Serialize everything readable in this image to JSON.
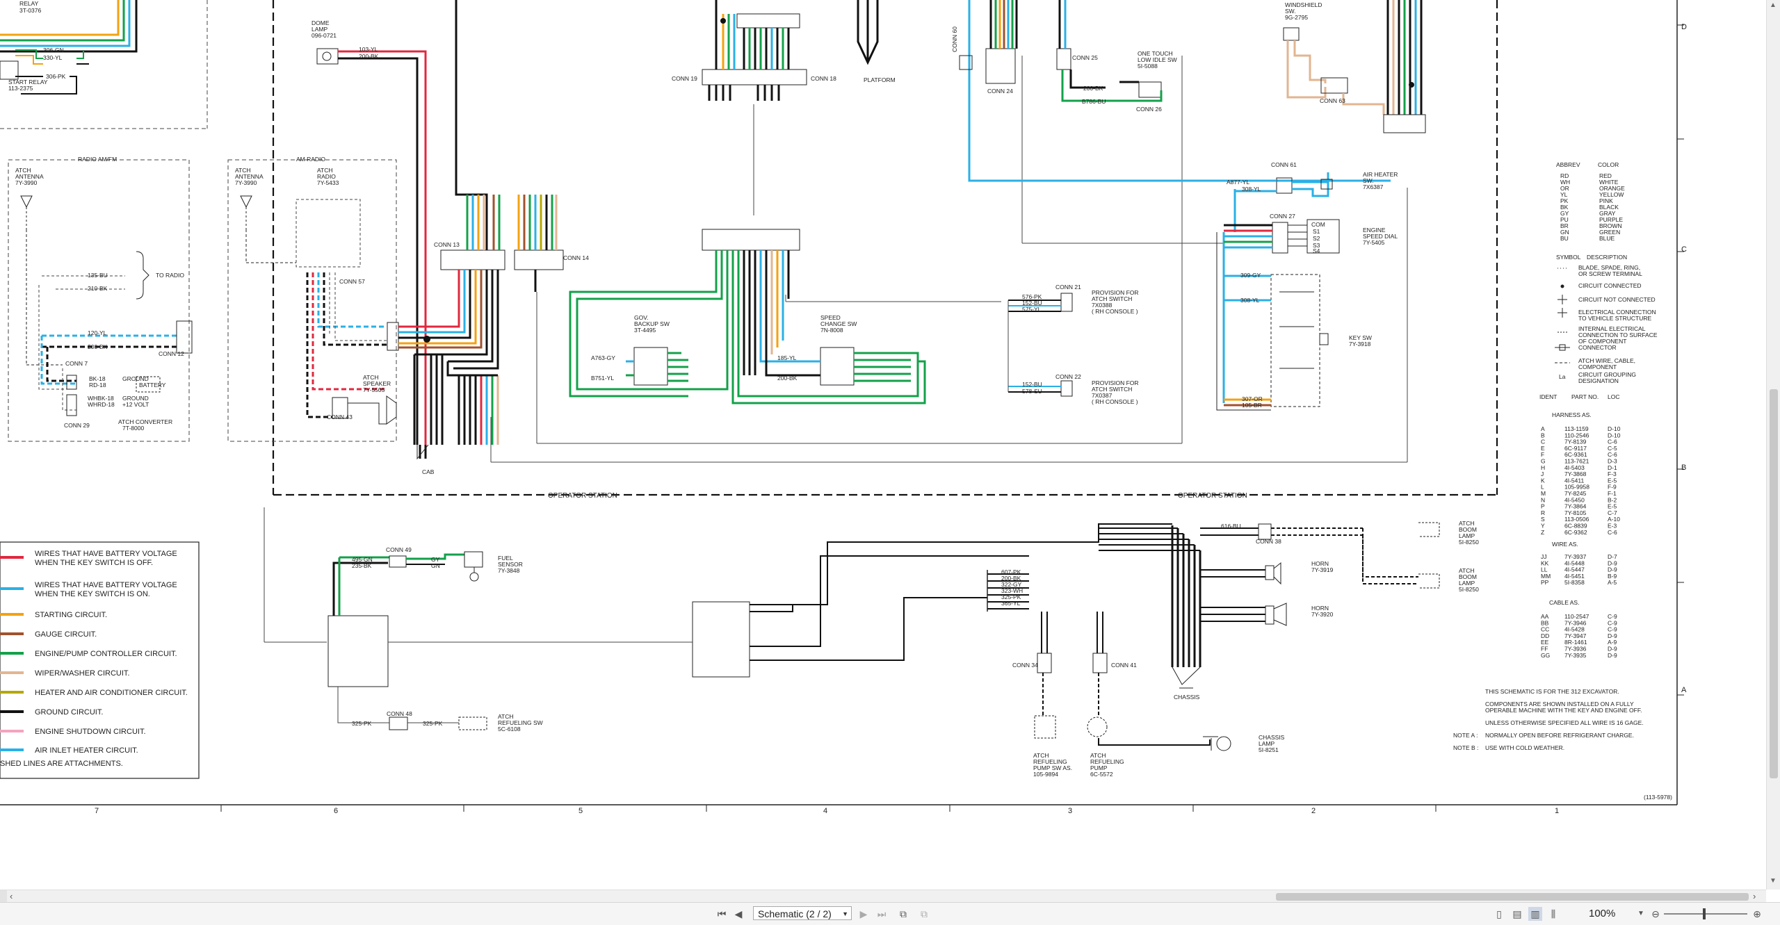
{
  "toolbar": {
    "page_label": "Schematic (2 / 2)",
    "zoom": "100%"
  },
  "grid": {
    "columns": [
      "7",
      "6",
      "5",
      "4",
      "3",
      "2",
      "1"
    ],
    "rows": [
      "D",
      "C",
      "B",
      "A"
    ]
  },
  "labels": {
    "relay": "RELAY",
    "relay_pn": "3T-0376",
    "start_relay": "START RELAY",
    "start_relay_pn": "113-2375",
    "w306gn": "306-GN",
    "w330yl": "330-YL",
    "w306pk": "306-PK",
    "dome": "DOME",
    "lamp": "LAMP",
    "dome_pn": "096-0721",
    "w103yl": "103-YL",
    "w200bk": "200-BK",
    "radio_amfm": "RADIO AM/FM",
    "am_radio": "AM RADIO",
    "atch": "ATCH",
    "antenna": "ANTENNA",
    "antenna_pn": "7Y-3990",
    "radio": "RADIO",
    "radio_pn": "7Y-5433",
    "to_radio": "TO RADIO",
    "w135bu": "135-BU",
    "w210bk": "210-BK",
    "w120yl": "120-YL",
    "conn7": "CONN 7",
    "conn29": "CONN 29",
    "conn12": "CONN 12",
    "conn13": "CONN 13",
    "conn14": "CONN 14",
    "conn57": "CONN 57",
    "conn43": "CONN 43",
    "conn19": "CONN 19",
    "conn18": "CONN 18",
    "conn24": "CONN 24",
    "conn25": "CONN 25",
    "conn26": "CONN 26",
    "conn61": "CONN 61",
    "conn27": "CONN 27",
    "conn63": "CONN 63",
    "conn21": "CONN 21",
    "conn22": "CONN 22",
    "conn38": "CONN 38",
    "conn49": "CONN 49",
    "conn48": "CONN 48",
    "conn34": "CONN 34",
    "conn41": "CONN 41",
    "wbk18": "BK-18",
    "wrd18": "RD-18",
    "wwhbk18": "WHBK-18",
    "wwhrd18": "WHRD-18",
    "ground": "GROUND",
    "battery": "BATTERY",
    "v12volt": "+12 VOLT",
    "atch_converter": "ATCH CONVERTER",
    "converter_pn": "7T-8000",
    "atch_speaker": "ATCH",
    "speaker": "SPEAKER",
    "speaker_pn": "7Y-5505",
    "cab": "CAB",
    "platform": "PLATFORM",
    "gov": "GOV.",
    "backup_sw": "BACKUP SW",
    "backup_pn": "3T-4495",
    "speed": "SPEED",
    "change_sw": "CHANGE SW",
    "change_pn": "7N-8008",
    "wa763gy": "A763-GY",
    "wb751yl": "B751-YL",
    "w185yl": "185-YL",
    "windshield": "WINDSHIELD",
    "sw": "SW.",
    "windshield_pn": "9G-2795",
    "one_touch": "ONE TOUCH",
    "low_idle_sw": "LOW IDLE SW",
    "low_idle_pn": "5I-5088",
    "wb786bu": "B786-BU",
    "air_heater": "AIR HEATER",
    "air_heater_pn": "7X6387",
    "wa877yl": "A877-YL",
    "w308yl": "308-YL",
    "engine": "ENGINE",
    "speed_dial": "SPEED DIAL",
    "dial_pn": "7Y-5405",
    "com": "COM",
    "s1": "S1",
    "s2": "S2",
    "s3": "S3",
    "s4": "S4",
    "key_sw": "KEY SW",
    "key_pn": "7Y-3918",
    "w309gy": "309-GY",
    "w307or": "307-OR",
    "w105br": "105-BR",
    "provision_for": "PROVISION FOR",
    "atch_switch": "ATCH SWITCH",
    "switch_pn1": "7X0388",
    "switch_pn2": "7X0387",
    "rh_console": "( RH CONSOLE )",
    "w576pk": "576-PK",
    "w152bu": "152-BU",
    "w575yl": "575-YL",
    "w578su": "578-SU",
    "operator_station": "OPERATOR STATION",
    "legend_battery_off_1": "WIRES THAT HAVE BATTERY VOLTAGE",
    "legend_battery_off_2": "WHEN THE KEY SWITCH IS OFF.",
    "legend_battery_on_1": "WIRES THAT HAVE BATTERY VOLTAGE",
    "legend_battery_on_2": "WHEN THE KEY SWITCH IS ON.",
    "legend_starting": "STARTING CIRCUIT.",
    "legend_gauge": "GAUGE CIRCUIT.",
    "legend_engine_pump": "ENGINE/PUMP CONTROLLER CIRCUIT.",
    "legend_wiper": "WIPER/WASHER CIRCUIT.",
    "legend_heater": "HEATER AND AIR CONDITIONER CIRCUIT.",
    "legend_ground": "GROUND CIRCUIT.",
    "legend_shutdown": "ENGINE SHUTDOWN CIRCUIT.",
    "legend_air_inlet": "AIR INLET HEATER CIRCUIT.",
    "legend_dashed": "SHED LINES ARE ATTACHMENTS.",
    "fuel": "FUEL",
    "sensor": "SENSOR",
    "fuel_pn": "7Y-3848",
    "w495gn": "495-GN",
    "w235bk": "235-BK",
    "gy": "GY",
    "gn": "GN",
    "w616bu": "616-BU",
    "w322gy": "322-GY",
    "w607pk": "607-PK",
    "w323wh": "323-WH",
    "w365yl": "365-YL",
    "w325pk": "325-PK",
    "refueling_sw": "REFUELING SW",
    "refueling_sw_pn": "5C-6108",
    "horn": "HORN",
    "horn_pn1": "7Y-3919",
    "horn_pn2": "7Y-3920",
    "boom": "BOOM",
    "boom_pn": "5I-8250",
    "chassis": "CHASSIS",
    "chassis_lamp": "CHASSIS",
    "chassis_lamp2": "LAMP",
    "chassis_lamp_pn": "5I-8251",
    "refueling": "REFUELING",
    "pump_sw_as": "PUMP SW AS.",
    "pump_sw_pn": "105-9894",
    "pump": "PUMP",
    "pump_pn": "6C-5572",
    "note_1": "THIS SCHEMATIC IS FOR THE 312 EXCAVATOR.",
    "note_2a": "COMPONENTS ARE SHOWN INSTALLED ON A FULLY",
    "note_2b": "OPERABLE MACHINE WITH THE KEY AND ENGINE OFF.",
    "note_3": "UNLESS OTHERWISE SPECIFIED ALL WIRE IS 16 GAGE.",
    "note_a_label": "NOTE A :",
    "note_a": "NORMALLY OPEN BEFORE REFRIGERANT CHARGE.",
    "note_b_label": "NOTE B :",
    "note_b": "USE WITH COLD WEATHER.",
    "doc_id": "(113-5978)",
    "abbrev_hdr": "ABBREV",
    "color_hdr": "COLOR",
    "symbol_hdr": "SYMBOL",
    "description_hdr": "DESCRIPTION",
    "sym1a": "BLADE, SPADE, RING,",
    "sym1b": "OR SCREW TERMINAL",
    "sym2": "CIRCUIT CONNECTED",
    "sym3": "CIRCUIT NOT CONNECTED",
    "sym4a": "ELECTRICAL CONNECTION",
    "sym4b": "TO VEHICLE STRUCTURE",
    "sym5a": "INTERNAL ELECTRICAL",
    "sym5b": "CONNECTION TO SURFACE",
    "sym5c": "OF COMPONENT",
    "sym6": "CONNECTOR",
    "sym7a": "ATCH WIRE, CABLE,",
    "sym7b": "COMPONENT",
    "sym8a": "CIRCUIT GROUPING",
    "sym8b": "DESIGNATION",
    "sym8_symbol": "La",
    "ident_hdr": "IDENT",
    "part_no_hdr": "PART NO.",
    "loc_hdr": "LOC",
    "harness_as": "HARNESS AS.",
    "wire_as": "WIRE AS.",
    "cable_as": "CABLE AS.",
    "conn60": "CONN 60"
  },
  "color_abbrev": [
    [
      "RD",
      "RED"
    ],
    [
      "WH",
      "WHITE"
    ],
    [
      "OR",
      "ORANGE"
    ],
    [
      "YL",
      "YELLOW"
    ],
    [
      "PK",
      "PINK"
    ],
    [
      "BK",
      "BLACK"
    ],
    [
      "GY",
      "GRAY"
    ],
    [
      "PU",
      "PURPLE"
    ],
    [
      "BR",
      "BROWN"
    ],
    [
      "GN",
      "GREEN"
    ],
    [
      "BU",
      "BLUE"
    ]
  ],
  "harness": [
    [
      "A",
      "113-1159",
      "D-10"
    ],
    [
      "B",
      "110-2546",
      "D-10"
    ],
    [
      "C",
      "7Y-8139",
      "C-6"
    ],
    [
      "E",
      "6C-9117",
      "C-5"
    ],
    [
      "F",
      "6C-9361",
      "C-6"
    ],
    [
      "G",
      "113-7621",
      "D-3"
    ],
    [
      "H",
      "4I-5403",
      "D-1"
    ],
    [
      "J",
      "7Y-3868",
      "F-3"
    ],
    [
      "K",
      "4I-5411",
      "E-5"
    ],
    [
      "L",
      "105-9958",
      "F-9"
    ],
    [
      "M",
      "7Y-8245",
      "F-1"
    ],
    [
      "N",
      "4I-5450",
      "B-2"
    ],
    [
      "P",
      "7Y-3864",
      "E-5"
    ],
    [
      "R",
      "7Y-8105",
      "C-7"
    ],
    [
      "S",
      "113-0506",
      "A-10"
    ],
    [
      "Y",
      "6C-8839",
      "E-3"
    ],
    [
      "Z",
      "6C-9362",
      "C-6"
    ]
  ],
  "wires": [
    [
      "JJ",
      "7Y-3937",
      "D-7"
    ],
    [
      "KK",
      "4I-5448",
      "D-9"
    ],
    [
      "LL",
      "4I-5447",
      "D-9"
    ],
    [
      "MM",
      "4I-5451",
      "B-9"
    ],
    [
      "PP",
      "5I-8358",
      "A-5"
    ]
  ],
  "cables": [
    [
      "AA",
      "110-2547",
      "C-9"
    ],
    [
      "BB",
      "7Y-3946",
      "C-9"
    ],
    [
      "CC",
      "4I-5428",
      "C-9"
    ],
    [
      "DD",
      "7Y-3947",
      "D-9"
    ],
    [
      "EE",
      "8R-1461",
      "A-9"
    ],
    [
      "FF",
      "7Y-3936",
      "D-9"
    ],
    [
      "GG",
      "7Y-3935",
      "D-9"
    ]
  ],
  "wire_colors": {
    "red": "#e0283f",
    "blue": "#2ab0e6",
    "orange": "#f3a20f",
    "brown": "#a0522d",
    "green": "#13a14a",
    "tan": "#e2b590",
    "olive": "#b5a800",
    "black": "#111111",
    "pink": "#f4a3c0"
  }
}
